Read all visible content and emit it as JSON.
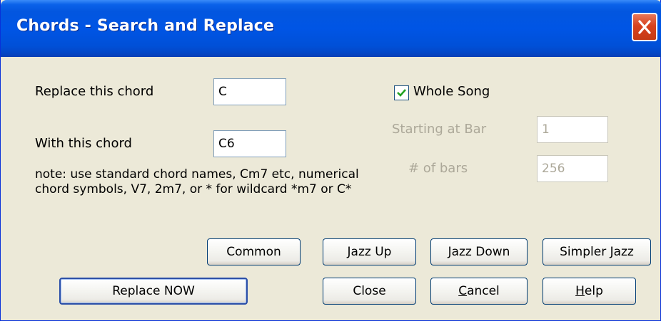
{
  "window": {
    "title": "Chords - Search and Replace"
  },
  "icons": {
    "close": "close-icon",
    "check": "checkmark-icon"
  },
  "form": {
    "replace_label": "Replace this chord",
    "replace_value": "C",
    "with_label": "With this chord",
    "with_value": "C6",
    "note_line1": "note: use standard chord names, Cm7 etc, numerical",
    "note_line2": "chord symbols, V7, 2m7, or * for wildcard *m7 or C*",
    "whole_song_label": "Whole Song",
    "whole_song_checked": true,
    "starting_bar_label": "Starting at Bar",
    "starting_bar_value": "1",
    "num_bars_label": "# of bars",
    "num_bars_value": "256"
  },
  "buttons": {
    "common": "Common",
    "jazz_up": "Jazz Up",
    "jazz_down": "Jazz Down",
    "simpler_jazz": "Simpler Jazz",
    "replace_now": "Replace NOW",
    "close": "Close",
    "cancel_underline": "C",
    "cancel_rest": "ancel",
    "help_underline": "H",
    "help_rest": "elp"
  },
  "colors": {
    "titlebar": "#0055e5",
    "dialog_bg": "#ece9d8",
    "disabled_text": "#aca899",
    "close_button": "#d8421e",
    "check": "#21a121"
  }
}
